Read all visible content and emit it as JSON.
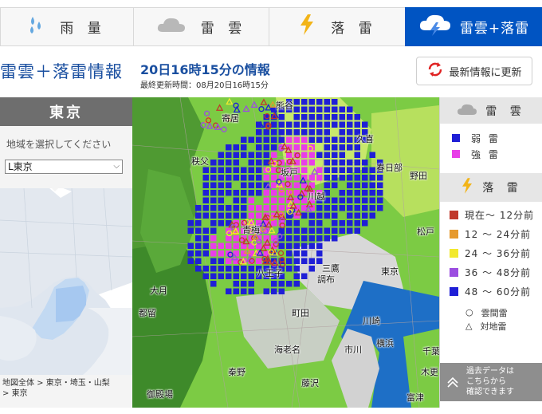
{
  "tabs": [
    {
      "label": "雨 量",
      "icon": "rain-icon"
    },
    {
      "label": "雷 雲",
      "icon": "cloud-icon"
    },
    {
      "label": "落 雷",
      "icon": "lightning-icon"
    },
    {
      "label": "雷雲+落雷",
      "icon": "cloud-lightning-icon"
    }
  ],
  "header": {
    "page_title": "雷雲＋落雷情報",
    "info_title": "20日16時15分の情報",
    "updated": "最終更新時間：08月20日16時15分",
    "refresh_label": "最新情報に更新"
  },
  "sidebar": {
    "region": "東京",
    "select_label": "地域を選択してください",
    "select_value": "L東京",
    "breadcrumb": [
      "地図全体",
      "東京・埼玉・山梨",
      "東京"
    ]
  },
  "map_labels": [
    "秩父",
    "寄居",
    "熊谷",
    "久喜",
    "春日部",
    "野田",
    "坂戸",
    "川越",
    "青梅",
    "八王子",
    "三鷹",
    "調布",
    "東京",
    "松戸",
    "大月",
    "都留",
    "町田",
    "川崎",
    "海老名",
    "秦野",
    "御殿場",
    "藤沢",
    "横浜",
    "市川",
    "富津",
    "木更",
    "千葉"
  ],
  "legend": {
    "cloud_header": "雷 雲",
    "cloud_items": [
      {
        "label": "弱 雷",
        "color": "#1f1fd6"
      },
      {
        "label": "強 雷",
        "color": "#e83ee8"
      }
    ],
    "strike_header": "落 雷",
    "strike_items": [
      {
        "label": "現在～ 12分前",
        "color": "#c0392b"
      },
      {
        "label": "12 ～ 24分前",
        "color": "#e69a2e"
      },
      {
        "label": "24 ～ 36分前",
        "color": "#f2e92e"
      },
      {
        "label": "36 ～ 48分前",
        "color": "#9b4de0"
      },
      {
        "label": "48 ～ 60分前",
        "color": "#1f1fd6"
      }
    ],
    "symbols": [
      {
        "shape": "○",
        "label": "雲間雷"
      },
      {
        "shape": "△",
        "label": "対地雷"
      }
    ],
    "past_text": [
      "過去データは",
      "こちらから",
      "確認できます"
    ]
  }
}
